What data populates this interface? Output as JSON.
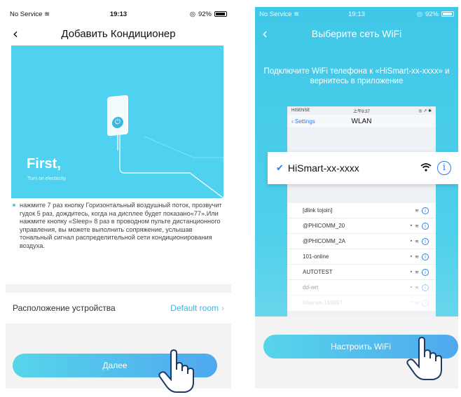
{
  "left_screen": {
    "status": {
      "carrier": "No Service",
      "time": "19:13",
      "battery": "92%"
    },
    "nav": {
      "back": "‹",
      "title": "Добавить Кондиционер"
    },
    "illustration": {
      "heading": "First,",
      "subheading": "Turn on electricity"
    },
    "instructions": "нажмите 7 раз кнопку Горизонтальный воздушный поток, прозвучит гудок 5 раз, дождитесь, когда на дисплее будет показано«77».Или нажмите кнопку «Sleep» 8 раз в проводном пульте дистанционного управления, вы можете выполнить сопряжение, услышав тональный сигнал распределительной сети кондиционирования воздуха.",
    "location": {
      "label": "Расположение устройства",
      "value": "Default room",
      "chevron": "›"
    },
    "next_button": "Далее"
  },
  "right_screen": {
    "status": {
      "carrier": "No Service",
      "time": "19:13",
      "battery": "92%"
    },
    "nav": {
      "back": "‹",
      "title": "Выберите сеть WiFi"
    },
    "instructions": "Подключите WiFi телефона к «HiSmart-xx-xxxx» и вернитесь в приложение",
    "mock_phone": {
      "status": {
        "carrier": "HISENSE",
        "time": "上午9:37",
        "icons": "◎ ↗ ✱"
      },
      "nav": {
        "back": "Settings",
        "title": "WLAN"
      },
      "selected_network": "HiSmart-xx-xxxx",
      "networks": [
        {
          "name": "[dlink tojoin]",
          "state": "normal",
          "locked": false
        },
        {
          "name": "@PHICOMM_20",
          "state": "normal",
          "locked": true
        },
        {
          "name": "@PHICOMM_2A",
          "state": "normal",
          "locked": true
        },
        {
          "name": "101-online",
          "state": "normal",
          "locked": true
        },
        {
          "name": "AUTOTEST",
          "state": "normal",
          "locked": true
        },
        {
          "name": "dd-wrt",
          "state": "dim",
          "locked": true
        },
        {
          "name": "hisense-169897",
          "state": "faded",
          "locked": true
        }
      ]
    },
    "wifi_button": "Настроить WiFi"
  },
  "colors": {
    "accent": "#4fd2f0",
    "button_start": "#56d5ea",
    "button_end": "#4fa8ee",
    "link": "#39b6de",
    "ios_blue": "#2b7cf6"
  }
}
